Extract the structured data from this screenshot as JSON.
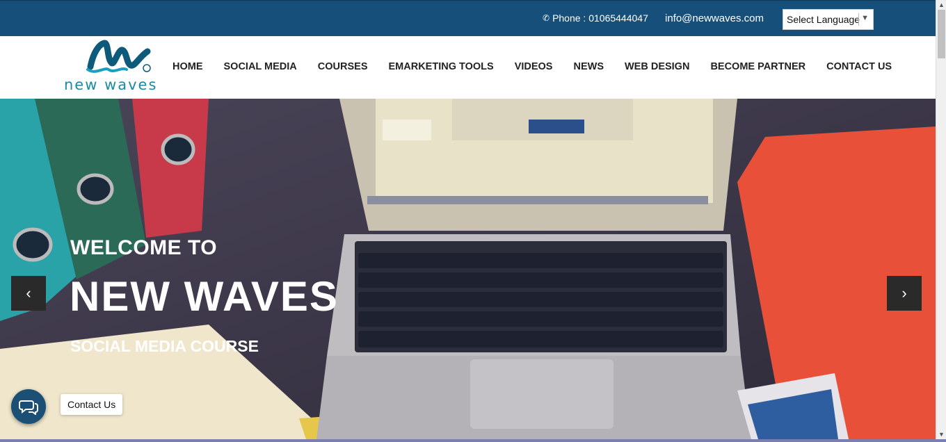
{
  "topbar": {
    "phone_icon": "phone-icon",
    "phone_text": "Phone : 01065444047",
    "email": "info@newwaves.com",
    "language_select": "Select Language"
  },
  "logo": {
    "text": "new waves"
  },
  "nav": {
    "items": [
      "HOME",
      "SOCIAL MEDIA",
      "COURSES",
      "EMARKETING TOOLS",
      "VIDEOS",
      "NEWS",
      "WEB DESIGN",
      "BECOME PARTNER",
      "CONTACT US"
    ]
  },
  "hero": {
    "welcome": "WELCOME TO",
    "brand": "NEW WAVES",
    "subtitle": "SOCIAL MEDIA COURSE",
    "prev_icon": "chevron-left-icon",
    "next_icon": "chevron-right-icon"
  },
  "chat": {
    "label": "Contact Us",
    "icon": "chat-bubbles-icon"
  },
  "colors": {
    "topbar": "#16507a",
    "accent": "#1a8aa6",
    "nav_text": "#222222"
  }
}
